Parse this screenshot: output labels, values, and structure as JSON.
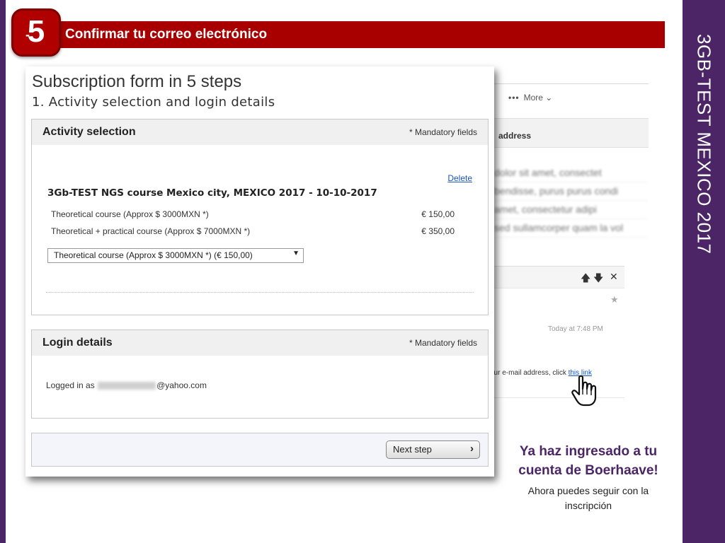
{
  "slide": {
    "step_number": "5",
    "step_dash": "-",
    "banner_title": "Confirmar tu correo electrónico",
    "side_title": "3GB-TEST MEXICO 2017",
    "colors": {
      "purple": "#4b2566",
      "red_banner": "#a80000"
    }
  },
  "email_bg": {
    "more_label": "More",
    "address_header": "address",
    "blurred_lines": [
      "dolor sit amet, consectet",
      "bendisse, purus purus condi",
      "amet, consectetur adipi",
      "sed sullamcorper quam la vol"
    ],
    "time": "Today at 7:48 PM",
    "text_prefix": "our e-mail address, click ",
    "link_text": "this link"
  },
  "form": {
    "title": "Subscription form in 5 steps",
    "subtitle": "1. Activity selection and login details",
    "activity": {
      "heading": "Activity selection",
      "mandatory": "* Mandatory fields",
      "delete_label": "Delete",
      "course_title": "3Gb-TEST NGS course Mexico city, MEXICO 2017 - 10-10-2017",
      "options": [
        {
          "label": "Theoretical course (Approx $ 3000MXN *)",
          "price": "€ 150,00"
        },
        {
          "label": "Theoretical + practical course (Approx $ 7000MXN *)",
          "price": "€ 350,00"
        }
      ],
      "selected": "Theoretical course (Approx $ 3000MXN *) (€ 150,00)"
    },
    "login": {
      "heading": "Login details",
      "mandatory": "* Mandatory fields",
      "logged_prefix": "Logged in as",
      "email_domain": "@yahoo.com"
    },
    "next_label": "Next step"
  },
  "confirmation": {
    "headline": "Ya haz ingresado a tu cuenta de Boerhaave!",
    "subtext": "Ahora puedes seguir con la inscripción"
  }
}
